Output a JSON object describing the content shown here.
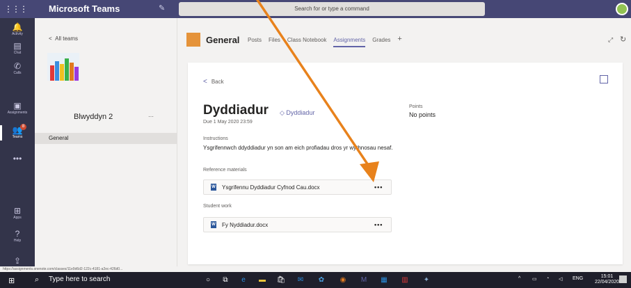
{
  "titlebar": {
    "app_title": "Microsoft Teams",
    "search_placeholder": "Search for or type a command"
  },
  "rail": {
    "items": [
      {
        "label": "Activity",
        "icon": "bell-icon"
      },
      {
        "label": "Chat",
        "icon": "chat-icon"
      },
      {
        "label": "Calls",
        "icon": "phone-icon"
      },
      {
        "label": "Assignments",
        "icon": "assignments-icon"
      },
      {
        "label": "Teams",
        "icon": "teams-icon",
        "badge": "8"
      },
      {
        "label": "•••",
        "icon": "more-icon"
      },
      {
        "label": "Apps",
        "icon": "apps-icon"
      },
      {
        "label": "Help",
        "icon": "help-icon"
      }
    ]
  },
  "teampanel": {
    "back_label": "All teams",
    "team_name": "Blwyddyn 2",
    "channel": "General"
  },
  "channel": {
    "title": "General",
    "tabs": [
      "Posts",
      "Files",
      "Class Notebook",
      "Assignments",
      "Grades"
    ]
  },
  "assignment": {
    "back_label": "Back",
    "title": "Dyddiadur",
    "category": "Dyddiadur",
    "due": "Due 1 May 2020 23:59",
    "points_label": "Points",
    "points_value": "No points",
    "instructions_label": "Instructions",
    "instructions_text": "Ysgrifennwch ddyddiadur yn son am eich profiadau dros yr wythnosau nesaf.",
    "reference_label": "Reference materials",
    "reference_file": "Ysgrifennu Dyddiadur Cyfnod Cau.docx",
    "student_label": "Student work",
    "student_file": "Fy Nyddiadur.docx"
  },
  "status_url": "https://assignments.onenote.com/classes/11e9d6d2-122c-4181-a2ec-426d0...",
  "taskbar": {
    "search_text": "Type here to search",
    "language": "ENG",
    "time": "15:01",
    "date": "22/04/2020"
  },
  "colors": {
    "brand": "#464775",
    "accent": "#6264a7",
    "arrow": "#e8821c"
  }
}
